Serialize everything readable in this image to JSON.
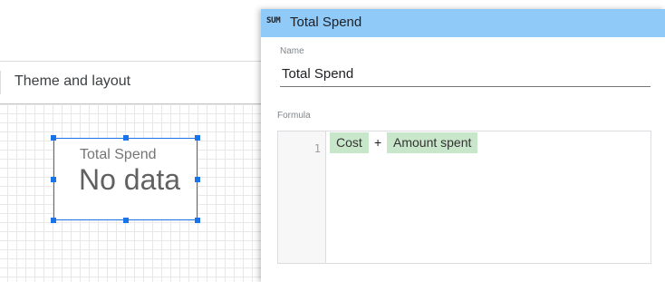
{
  "toolbar": {
    "theme_label": "Theme and layout"
  },
  "scorecard": {
    "title": "Total Spend",
    "value": "No data"
  },
  "panel": {
    "type_icon": "SUM",
    "title": "Total Spend",
    "name_label": "Name",
    "name_value": "Total Spend",
    "formula_label": "Formula",
    "formula": {
      "line_number": "1",
      "tokens": [
        {
          "kind": "field",
          "text": "Cost"
        },
        {
          "kind": "operator",
          "text": "+"
        },
        {
          "kind": "field",
          "text": "Amount spent"
        }
      ]
    }
  },
  "colors": {
    "header_bg": "#90caf9",
    "chip_bg": "#c8e6c9",
    "selection": "#1a73e8"
  }
}
